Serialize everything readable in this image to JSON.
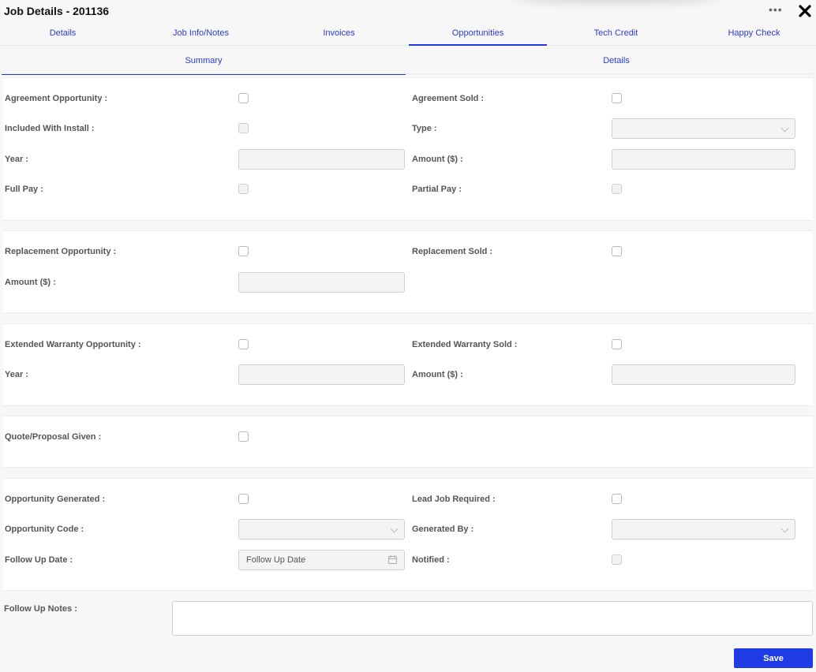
{
  "header": {
    "title": "Job Details - 201136",
    "more_icon": "ellipsis-icon",
    "close_icon": "close-x-icon"
  },
  "tabs": [
    {
      "label": "Details",
      "active": false
    },
    {
      "label": "Job Info/Notes",
      "active": false
    },
    {
      "label": "Invoices",
      "active": false
    },
    {
      "label": "Opportunities",
      "active": true
    },
    {
      "label": "Tech Credit",
      "active": false
    },
    {
      "label": "Happy Check",
      "active": false
    }
  ],
  "subtabs": [
    {
      "label": "Summary",
      "active": true
    },
    {
      "label": "Details",
      "active": false
    }
  ],
  "agreement": {
    "agreement_opportunity": {
      "label": "Agreement Opportunity :",
      "checked": false
    },
    "agreement_sold": {
      "label": "Agreement Sold :",
      "checked": false
    },
    "included_with_install": {
      "label": "Included With Install :",
      "checked": false,
      "disabled": true
    },
    "type": {
      "label": "Type :",
      "value": ""
    },
    "year": {
      "label": "Year :",
      "value": ""
    },
    "amount": {
      "label": "Amount ($) :",
      "value": ""
    },
    "full_pay": {
      "label": "Full Pay :",
      "checked": false,
      "disabled": true
    },
    "partial_pay": {
      "label": "Partial Pay :",
      "checked": false,
      "disabled": true
    }
  },
  "replacement": {
    "replacement_opportunity": {
      "label": "Replacement Opportunity :",
      "checked": false
    },
    "replacement_sold": {
      "label": "Replacement Sold :",
      "checked": false
    },
    "amount": {
      "label": "Amount ($) :",
      "value": ""
    }
  },
  "extended_warranty": {
    "opportunity": {
      "label": "Extended Warranty Opportunity :",
      "checked": false
    },
    "sold": {
      "label": "Extended Warranty  Sold :",
      "checked": false
    },
    "year": {
      "label": "Year :",
      "value": ""
    },
    "amount": {
      "label": "Amount ($) :",
      "value": ""
    }
  },
  "quote": {
    "quote_proposal_given": {
      "label": "Quote/Proposal Given :",
      "checked": false
    }
  },
  "opportunity": {
    "opportunity_generated": {
      "label": "Opportunity Generated :",
      "checked": false
    },
    "lead_job_required": {
      "label": "Lead Job Required :",
      "checked": false
    },
    "opportunity_code": {
      "label": "Opportunity Code :",
      "value": ""
    },
    "generated_by": {
      "label": "Generated By :",
      "value": ""
    },
    "follow_up_date": {
      "label": "Follow Up Date :",
      "placeholder": "Follow Up Date",
      "value": ""
    },
    "notified": {
      "label": "Notified :",
      "checked": false,
      "disabled": true
    }
  },
  "follow_up_notes": {
    "label": "Follow Up Notes :",
    "value": ""
  },
  "actions": {
    "save_label": "Save"
  },
  "colors": {
    "accent": "#1f3be6",
    "tab_text": "#2a3bd4",
    "label": "#555555",
    "background": "#f7f7f7"
  }
}
